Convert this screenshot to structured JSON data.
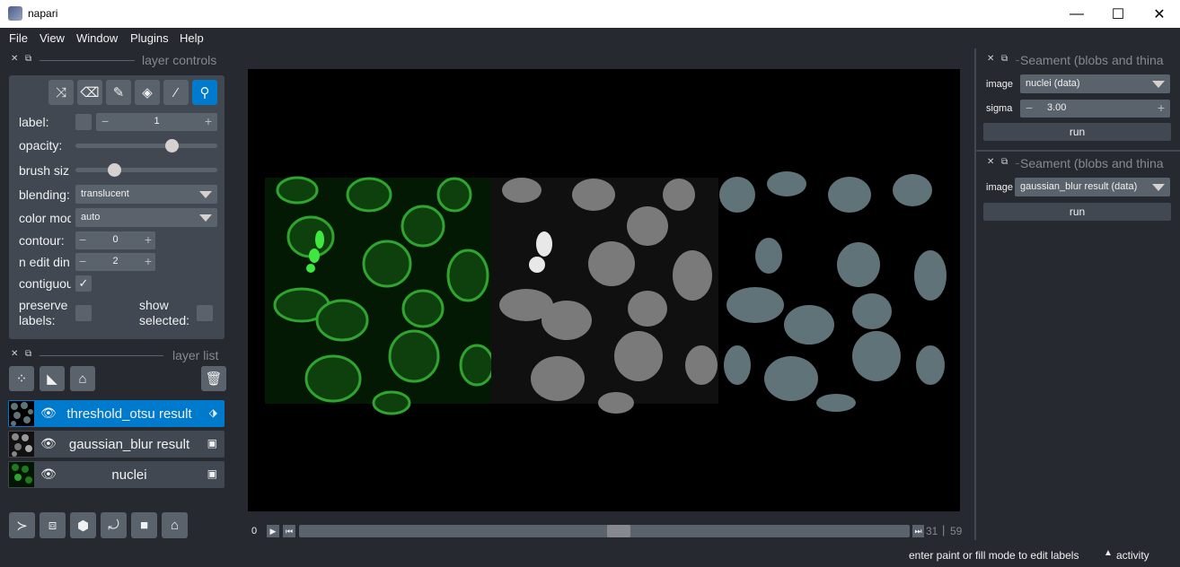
{
  "window": {
    "title": "napari",
    "minimize": "—",
    "maximize": "☐",
    "close": "✕"
  },
  "menu": [
    "File",
    "View",
    "Window",
    "Plugins",
    "Help"
  ],
  "layer_controls": {
    "title": "layer controls",
    "label_label": "label:",
    "label_value": "1",
    "opacity_label": "opacity:",
    "opacity_value": 0.7,
    "brush_label": "brush siz",
    "brush_value": 0.25,
    "blending_label": "blending:",
    "blending_value": "translucent",
    "colormode_label": "color mod",
    "colormode_value": "auto",
    "contour_label": "contour:",
    "contour_value": "0",
    "ndim_label": "n edit din",
    "ndim_value": "2",
    "contiguous_label": "contiguou",
    "preserve_label": "preserve labels:",
    "show_selected_label": "show selected:"
  },
  "layer_list": {
    "title": "layer list",
    "layers": [
      {
        "name": "threshold_otsu result",
        "type_icon": "tag-icon",
        "selected": true
      },
      {
        "name": "gaussian_blur result",
        "type_icon": "image-icon",
        "selected": false
      },
      {
        "name": "nuclei",
        "type_icon": "image-icon",
        "selected": false
      }
    ]
  },
  "slider": {
    "start": "0",
    "end_a": "31",
    "end_b": "59"
  },
  "right_panels": [
    {
      "title": "Seament (blobs and thina",
      "image_label": "image",
      "image_value": "nuclei (data)",
      "sigma_label": "sigma",
      "sigma_value": "3.00",
      "run_label": "run"
    },
    {
      "title": "Seament (blobs and thina",
      "image_label": "image",
      "image_value": "gaussian_blur result (data)",
      "run_label": "run"
    }
  ],
  "status": {
    "message": "enter paint or fill mode to edit labels",
    "activity": "activity"
  },
  "colors": {
    "accent": "#007acc",
    "bg": "#262930",
    "panel": "#414851",
    "green": "#2fa52f",
    "label_fill": "#5f7378"
  }
}
